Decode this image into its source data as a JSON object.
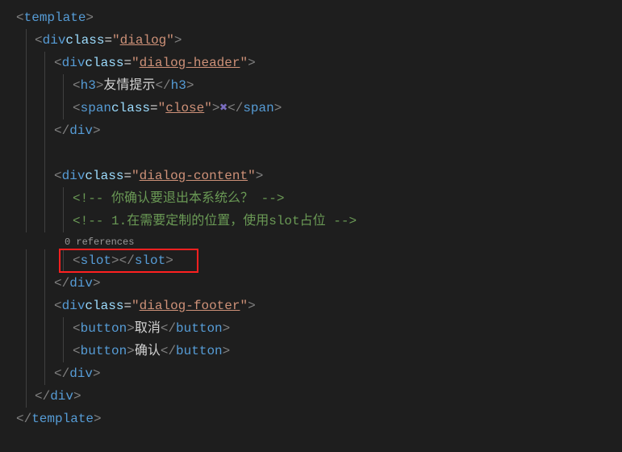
{
  "code": {
    "template_open": "template",
    "template_close": "template",
    "div": "div",
    "h3": "h3",
    "span": "span",
    "slot": "slot",
    "button": "button",
    "class_attr": "class",
    "dialog": "dialog",
    "dialog_header": "dialog-header",
    "dialog_content": "dialog-content",
    "dialog_footer": "dialog-footer",
    "close": "close",
    "h3_text": "友情提示",
    "cross_icon": "✖",
    "comment1": "你确认要退出本系统么？",
    "comment2": "1.在需要定制的位置，使用slot占位",
    "btn_cancel": "取消",
    "btn_confirm": "确认",
    "codelens": "0 references"
  }
}
